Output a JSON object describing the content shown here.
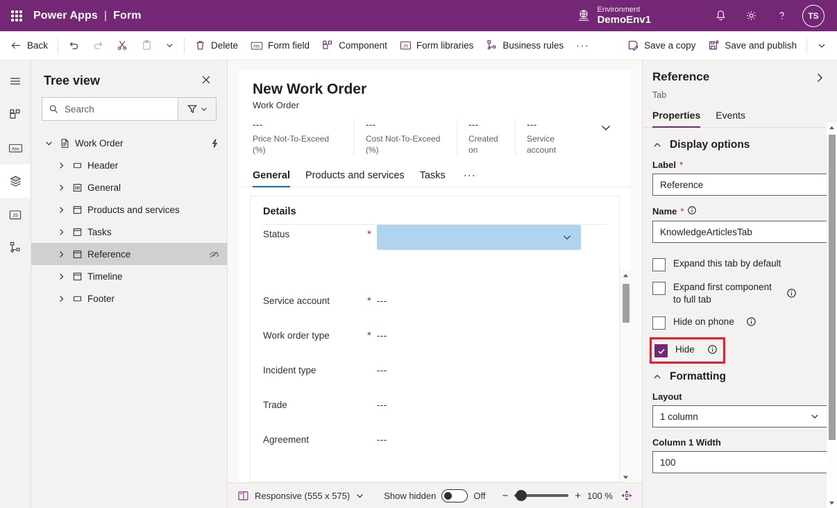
{
  "topbar": {
    "waffle_icon": "app-launcher-icon",
    "brand": "Power Apps",
    "separator": "|",
    "page": "Form",
    "environment_label": "Environment",
    "environment_name": "DemoEnv1",
    "environment_icon": "globe-icon",
    "notifications_icon": "bell-icon",
    "settings_icon": "gear-icon",
    "help_icon": "question-mark-icon",
    "avatar_initials": "TS",
    "background": "#742774"
  },
  "commandbar": {
    "back": "Back",
    "undo_icon": "undo-icon",
    "redo_icon": "redo-icon",
    "cut_icon": "scissors-icon",
    "paste_icon": "clipboard-icon",
    "paste_chevron_icon": "chevron-down-icon",
    "delete": "Delete",
    "form_field": "Form field",
    "component": "Component",
    "form_libraries": "Form libraries",
    "business_rules": "Business rules",
    "overflow": "···",
    "save_a_copy": "Save a copy",
    "save_and_publish": "Save and publish",
    "save_chevron_icon": "chevron-down-icon"
  },
  "rail": {
    "items": [
      {
        "icon": "hamburger-menu-icon",
        "active": false
      },
      {
        "icon": "components-icon",
        "active": false
      },
      {
        "icon": "abc-text-field-icon",
        "active": false
      },
      {
        "icon": "layers-stack-icon",
        "active": true
      },
      {
        "icon": "js-script-icon",
        "active": false
      },
      {
        "icon": "business-rules-icon",
        "active": false
      }
    ]
  },
  "treeview": {
    "title": "Tree view",
    "close_icon": "close-icon",
    "search_icon": "search-icon",
    "search_placeholder": "Search",
    "search_value": "",
    "filter_icon": "filter-icon",
    "filter_chevron_icon": "chevron-down-icon",
    "nodes": [
      {
        "label": "Work Order",
        "icon": "form-page-icon",
        "indent": 0,
        "chevron": "expanded",
        "selected": false,
        "trail_icon": "lightning-bolt-icon"
      },
      {
        "label": "Header",
        "icon": "header-section-icon",
        "indent": 1,
        "chevron": "collapsed",
        "selected": false,
        "trail_icon": ""
      },
      {
        "label": "General",
        "icon": "tab-columns-icon",
        "indent": 1,
        "chevron": "collapsed",
        "selected": false,
        "trail_icon": ""
      },
      {
        "label": "Products and services",
        "icon": "tab-icon",
        "indent": 1,
        "chevron": "collapsed",
        "selected": false,
        "trail_icon": ""
      },
      {
        "label": "Tasks",
        "icon": "tab-icon",
        "indent": 1,
        "chevron": "collapsed",
        "selected": false,
        "trail_icon": ""
      },
      {
        "label": "Reference",
        "icon": "tab-icon",
        "indent": 1,
        "chevron": "collapsed",
        "selected": true,
        "trail_icon": "hidden-eye-icon"
      },
      {
        "label": "Timeline",
        "icon": "tab-icon",
        "indent": 1,
        "chevron": "collapsed",
        "selected": false,
        "trail_icon": ""
      },
      {
        "label": "Footer",
        "icon": "header-section-icon",
        "indent": 1,
        "chevron": "collapsed",
        "selected": false,
        "trail_icon": ""
      }
    ]
  },
  "canvas": {
    "form_title": "New Work Order",
    "form_subtitle": "Work Order",
    "header_fields": [
      {
        "value": "---",
        "label": "Price Not-To-Exceed (%)"
      },
      {
        "value": "---",
        "label": "Cost Not-To-Exceed (%)"
      },
      {
        "value": "---",
        "label": "Created on"
      },
      {
        "value": "---",
        "label": "Service account"
      }
    ],
    "header_expand_icon": "chevron-down-icon",
    "tabs": [
      {
        "label": "General",
        "active": true
      },
      {
        "label": "Products and services",
        "active": false
      },
      {
        "label": "Tasks",
        "active": false
      }
    ],
    "tabs_overflow": "···",
    "insertion_marker_color": "#742774",
    "details_title": "Details",
    "fields": [
      {
        "label": "Status",
        "required": true,
        "value": "",
        "control": "combobox",
        "selected": true,
        "chevron_icon": "chevron-down-icon"
      },
      {
        "label": "Service account",
        "required": true,
        "value": "---",
        "control": "text",
        "selected": false
      },
      {
        "label": "Work order type",
        "required": true,
        "value": "---",
        "control": "text",
        "selected": false
      },
      {
        "label": "Incident type",
        "required": false,
        "value": "---",
        "control": "text",
        "selected": false
      },
      {
        "label": "Trade",
        "required": false,
        "value": "---",
        "control": "text",
        "selected": false
      },
      {
        "label": "Agreement",
        "required": false,
        "value": "---",
        "control": "text",
        "selected": false
      }
    ],
    "selected_control_color": "#aed4ef",
    "scroll_up_icon": "caret-up-icon",
    "scroll_down_icon": "caret-down-icon"
  },
  "statusbar": {
    "screen_icon": "responsive-layout-icon",
    "screen_size": "Responsive (555 x 575)",
    "screen_chevron_icon": "chevron-down-icon",
    "show_hidden_label": "Show hidden",
    "show_hidden_state": "Off",
    "zoom_minus": "−",
    "zoom_plus": "+",
    "zoom_level": "100 %",
    "fit_icon": "fit-to-screen-icon"
  },
  "properties": {
    "title": "Reference",
    "expand_icon": "chevron-right-icon",
    "subtitle": "Tab",
    "tabs": [
      {
        "label": "Properties",
        "active": true
      },
      {
        "label": "Events",
        "active": false
      }
    ],
    "accent": "#742774",
    "sections": [
      {
        "name": "Display options",
        "collapse_icon": "chevron-up-icon",
        "label_field": {
          "label": "Label",
          "required": true,
          "value": "Reference"
        },
        "name_field": {
          "label": "Name",
          "required": true,
          "value": "KnowledgeArticlesTab",
          "info_icon": "info-icon"
        },
        "checkboxes": [
          {
            "label": "Expand this tab by default",
            "checked": false,
            "info_icon": ""
          },
          {
            "label": "Expand first component to full tab",
            "checked": false,
            "info_icon": "info-icon"
          },
          {
            "label": "Hide on phone",
            "checked": false,
            "info_icon": "info-icon"
          },
          {
            "label": "Hide",
            "checked": true,
            "info_icon": "info-icon",
            "highlighted": true,
            "highlight_color": "#ee1d2b"
          }
        ]
      },
      {
        "name": "Formatting",
        "collapse_icon": "chevron-up-icon",
        "layout_label": "Layout",
        "layout_value": "1 column",
        "layout_chevron_icon": "chevron-down-icon",
        "width_label": "Column 1 Width",
        "width_value": "100"
      }
    ],
    "scroll_up_icon": "caret-up-icon",
    "scroll_down_icon": "caret-down-icon"
  }
}
